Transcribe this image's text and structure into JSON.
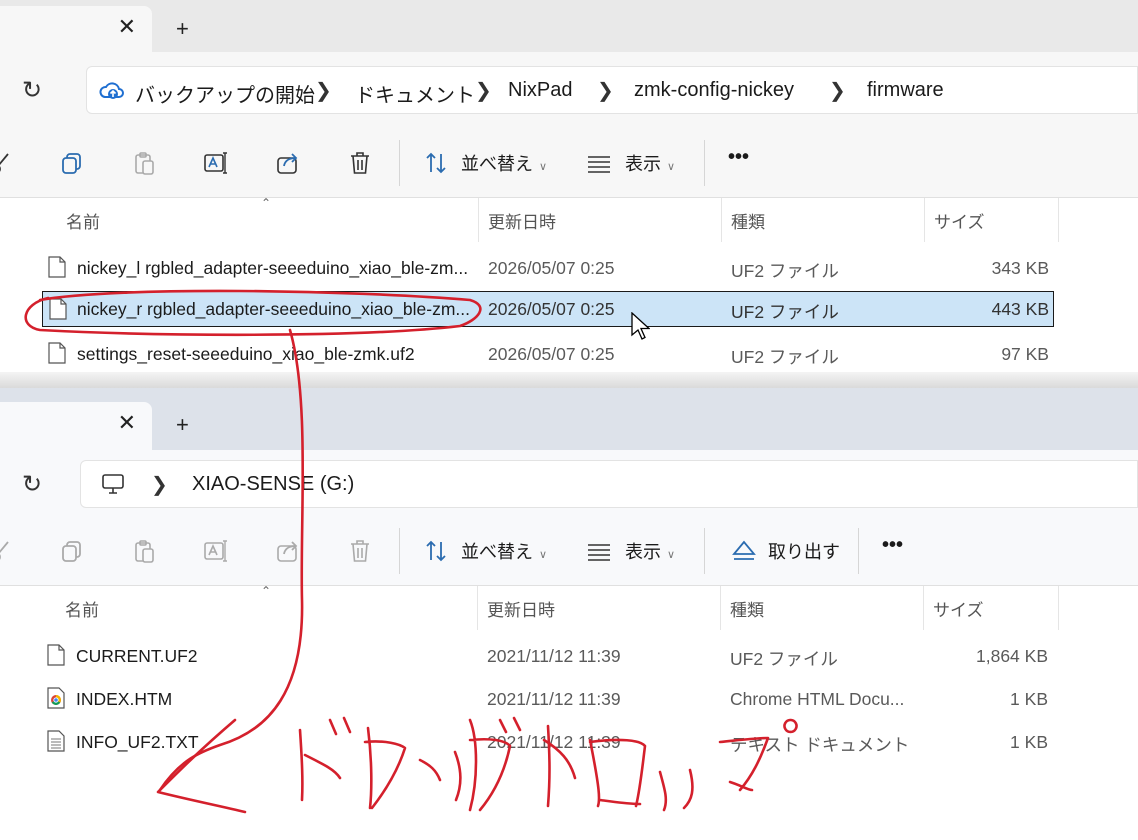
{
  "window1": {
    "tab": {
      "close": "✕",
      "add": "+"
    },
    "breadcrumb": [
      "バックアップの開始",
      "ドキュメント",
      "NixPad",
      "zmk-config-nickey",
      "firmware"
    ],
    "toolbar": {
      "sort": "並べ替え",
      "view": "表示",
      "more": "•••"
    },
    "columns": [
      "名前",
      "更新日時",
      "種類",
      "サイズ"
    ],
    "files": [
      {
        "name": "nickey_l rgbled_adapter-seeeduino_xiao_ble-zm...",
        "date": "2026/05/07 0:25",
        "type": "UF2 ファイル",
        "size": "343 KB"
      },
      {
        "name": "nickey_r rgbled_adapter-seeeduino_xiao_ble-zm...",
        "date": "2026/05/07 0:25",
        "type": "UF2 ファイル",
        "size": "443 KB"
      },
      {
        "name": "settings_reset-seeeduino_xiao_ble-zmk.uf2",
        "date": "2026/05/07 0:25",
        "type": "UF2 ファイル",
        "size": "97 KB"
      }
    ]
  },
  "window2": {
    "tab": {
      "close": "✕",
      "add": "+"
    },
    "breadcrumb": [
      "XIAO-SENSE (G:)"
    ],
    "toolbar": {
      "sort": "並べ替え",
      "view": "表示",
      "eject": "取り出す",
      "more": "•••"
    },
    "columns": [
      "名前",
      "更新日時",
      "種類",
      "サイズ"
    ],
    "files": [
      {
        "name": "CURRENT.UF2",
        "date": "2021/11/12 11:39",
        "type": "UF2 ファイル",
        "size": "1,864 KB"
      },
      {
        "name": "INDEX.HTM",
        "date": "2021/11/12 11:39",
        "type": "Chrome HTML Docu...",
        "size": "1 KB"
      },
      {
        "name": "INFO_UF2.TXT",
        "date": "2021/11/12 11:39",
        "type": "テキスト ドキュメント",
        "size": "1 KB"
      }
    ]
  },
  "annotation": {
    "text": "ドラッグ&ドロップ",
    "color": "#d4202c"
  }
}
